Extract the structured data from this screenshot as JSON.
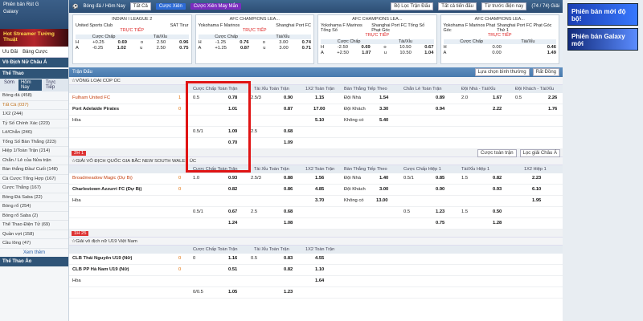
{
  "sidebar": {
    "brand": "Phiên bản Rút G",
    "brand2": "Galaxy",
    "banner": "Hot Streamer Tưởng Thuật",
    "ctrl_left": "Ưu Đãi",
    "ctrl_right": "Bảng Cược",
    "section_vdn": "Vô Địch Nữ Châu Á",
    "section_sport": "Thể Thao",
    "tabs": [
      "Sớm",
      "Hôm Nay",
      "Trực Tiếp"
    ],
    "items": [
      "Bóng đá (458)",
      "Tất Cả (037)",
      "1X2 (244)",
      "Tỷ Số Chính Xác (223)",
      "Lẻ/Chẵn (246)",
      "Tổng Số Bàn Thắng (223)",
      "Hiệp 1/Toàn Trận (214)",
      "Chẵn / Lẻ của Nửa trận",
      "Bàn thắng Đầu/ Cuối (148)",
      "Cá Cược Tổng Hợp (167)",
      "Cược Thắng (167)",
      "Bóng Đá Saba (22)",
      "Bóng rổ (254)",
      "Bóng rổ Saba (2)",
      "Thể Thao Điện Tử (69)",
      "Quần vợt (158)",
      "Cầu lông (47)"
    ],
    "more": "Xem thêm",
    "section_bottom": "Thể Thao Ảo"
  },
  "topbar": {
    "sport": "Bóng đá / Hôm Nay",
    "filter": "Tất Cả",
    "btn_xien": "Cược Xiên",
    "btn_may": "Cược Xiên May Mắn",
    "filter_league": "Bộ Lọc Trận Đấu",
    "filter_market": "Tất cả tiến đấu",
    "sort": "Từ trước điện nay",
    "page": "(74 / 74) Giải"
  },
  "cards": [
    {
      "league": "INDIAN I LEAGUE 2",
      "home": "United Sports Club",
      "live": "TRỰC TIẾP",
      "time": "04:30PM",
      "away": "SAT Tirur",
      "m1": "Cược Chấp",
      "m2": "Tài/Xỉu",
      "r1": [
        "H",
        "+0.25",
        "0.69",
        "o",
        "2.50",
        "0.96"
      ],
      "r2": [
        "A",
        "-0.25",
        "1.02",
        "u",
        "2.50",
        "0.75"
      ]
    },
    {
      "league": "AFC CHAMPIONS LEA...",
      "home": "Yokohama F Marinos",
      "live": "TRỰC TIẾP",
      "time": "05:00PM",
      "away": "Shanghai Port FC",
      "m1": "Cược Chấp",
      "m2": "Tài/Xỉu",
      "r1": [
        "H",
        "-1.25",
        "0.76",
        "o",
        "3.00",
        "0.74"
      ],
      "r2": [
        "A",
        "+1.25",
        "0.87",
        "u",
        "3.00",
        "0.71"
      ]
    },
    {
      "league": "AFC CHAMPIONS LEA...",
      "home": "Yokohama F Marinos Tổng Số",
      "live": "TRỰC TIẾP",
      "time": "05:00PM",
      "away": "Shanghai Port FC Tổng Số Phạt Góc",
      "m1": "Cược Chấp",
      "m2": "Tài/Xỉu",
      "r1": [
        "H",
        "-2.50",
        "0.69",
        "o",
        "10.50",
        "0.67"
      ],
      "r2": [
        "A",
        "+2.50",
        "1.07",
        "u",
        "10.50",
        "1.04"
      ]
    },
    {
      "league": "AFC CHAMPIONS LEA...",
      "home": "Yokohama F Marinos Phạt Góc",
      "live": "TRỰC TIẾP",
      "time": "05:00PM",
      "away": "Shanghai Port FC Phạt Góc Thứ 1",
      "m1": "Cược Chấp",
      "m2": "Tài/Xỉu",
      "r1": [
        "H",
        "0.00",
        "",
        "",
        "",
        "0.46"
      ],
      "r2": [
        "A",
        "0.00",
        "",
        "",
        "",
        "1.49"
      ]
    }
  ],
  "main": {
    "bar1": "Trận Đấu",
    "bar1_right1": "Lựa chọn bình thường",
    "bar1_right2": "Rất Đồng",
    "league1": "VÒNG LOẠI CÚP ÚC",
    "cols1": [
      "Cược Chấp Toàn Trận",
      "Tài Xỉu Toàn Trận",
      "1X2 Toàn Trận",
      "Bàn Thắng Tiếp Theo",
      "Chẵn Lẻ Toàn Trận",
      "Đội Nhà - Tài/Xỉu",
      "Đội Khách - Tài/Xỉu"
    ],
    "m1": {
      "home": "Fulham United FC",
      "away": "Port Adelaide Pirates",
      "draw": "Hòa",
      "h_score": "1",
      "a_score": "0",
      "hcp_line": "0.5",
      "hcp_h": "0.78",
      "hcp_a": "1.01",
      "ou_line": "2.5/3",
      "ou_o": "0.90",
      "ou_u": "0.87",
      "x_h": "1.15",
      "x_a": "17.00",
      "x_d": "5.10",
      "nt_h_lbl": "Đội Nhà",
      "nt_h": "1.54",
      "nt_a_lbl": "Đội Khách",
      "nt_a": "3.30",
      "nt_n_lbl": "Không có",
      "nt_n": "5.40",
      "oe_o": "0.89",
      "oe_e": "0.94",
      "hou_o_line": "2.0",
      "hou_o": "1.67",
      "hou_u": "2.22",
      "aou_o_line": "0.5",
      "aou_o": "2.26",
      "aou_u": "1.76",
      "hcp2_line": "0.5/1",
      "hcp2_h": "1.09",
      "hcp2_a": "0.70",
      "ou2_line": "2.5",
      "ou2_o": "0.68",
      "ou2_u": "1.09"
    },
    "grp1_left": "2H 1",
    "grp1_right1": "Cược toàn trận",
    "grp1_right2": "Lọc giải Châu Á",
    "league2": "GIẢI VÔ ĐỊCH QUỐC GIA BẮC NEW SOUTH WALES ÚC",
    "cols2": [
      "Cược Chấp Toàn Trận",
      "Tài Xỉu Toàn Trận",
      "1X2 Toàn Trận",
      "Bàn Thắng Tiếp Theo",
      "Cược Chấp Hiệp 1",
      "Tài/Xỉu Hiệp 1",
      "1X2 Hiệp 1"
    ],
    "m2": {
      "home": "Broadmeadow Magic (Dự Bị)",
      "away": "Charlestown Azzurri FC (Dự Bị)",
      "draw": "Hòa",
      "h_score": "0",
      "a_score": "0",
      "hcp_line": "1.0",
      "hcp_h": "0.93",
      "hcp_a": "0.82",
      "ou_line": "2.5/3",
      "ou_o": "0.88",
      "ou_u": "0.86",
      "x_h": "1.56",
      "x_a": "4.85",
      "x_d": "3.70",
      "nt_h_lbl": "Đội Nhà",
      "nt_h": "1.40",
      "nt_a_lbl": "Đội Khách",
      "nt_a": "3.00",
      "nt_n_lbl": "Không có",
      "nt_n": "13.00",
      "h1_line": "0.5/1",
      "h1_h": "0.85",
      "h1_a": "0.90",
      "h1ou_line": "1.5",
      "h1ou_o": "0.82",
      "h1ou_u": "0.93",
      "h1x_h": "2.23",
      "h1x_a": "6.10",
      "h1x_d": "1.95",
      "hcp2_line": "0.5/1",
      "hcp2_h": "0.67",
      "hcp2_a": "1.24",
      "ou2_line": "2.5",
      "ou2_o": "0.68",
      "ou2_u": "1.08",
      "h12_line": "0.5",
      "h12_h": "1.23",
      "h12_a": "0.75",
      "h12ou_line": "1.5",
      "h12ou_o": "0.50",
      "h12ou_u": "1.28"
    },
    "grp2_left": "1H 25",
    "league3": "Giải vô địch nữ U19 Việt Nam",
    "cols3": [
      "Cược Chấp Toàn Trận",
      "Tài Xỉu Toàn Trận",
      "1X2 Toàn Trận"
    ],
    "m3": {
      "home": "CLB Thái Nguyên U19 (Nữ)",
      "away": "CLB PP Hà Nam U19 (Nữ)",
      "draw": "Hòa",
      "h_score": "0",
      "a_score": "0",
      "hcp_line": "0",
      "hcp_h": "1.16",
      "hcp_a": "0.51",
      "ou_line": "0.5",
      "ou_o": "0.83",
      "ou_u": "0.82",
      "x_h": "4.55",
      "x_a": "1.10",
      "x_d": "1.64",
      "hcp2_line": "0/0.5",
      "hcp2_h": "1.05",
      "ou2_o": "1.23"
    }
  },
  "ads": [
    "Phiên bản mới độ bộ!",
    "Phiên bản Galaxy mới"
  ]
}
